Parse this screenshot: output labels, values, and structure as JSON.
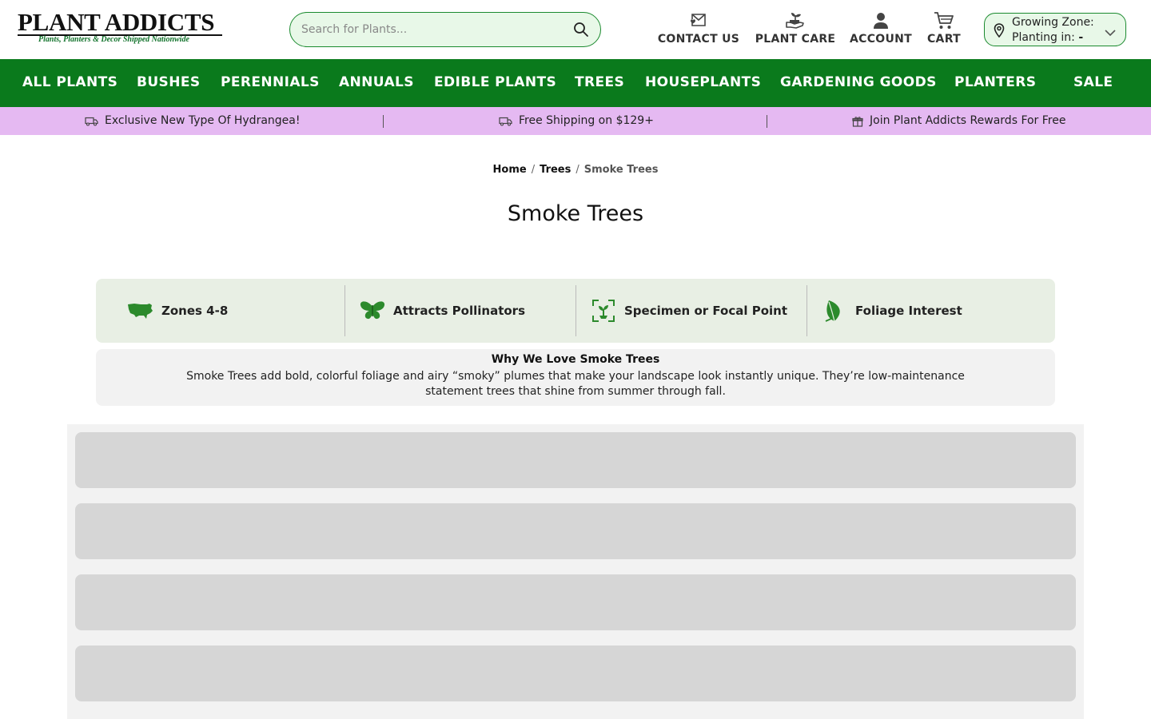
{
  "header": {
    "logo_title": "PLANT ADDICTS",
    "logo_tagline": "Plants, Planters & Decor Shipped Nationwide",
    "search_placeholder": "Search for Plants...",
    "links": [
      {
        "label": "CONTACT US",
        "icon": "envelope-heart-icon"
      },
      {
        "label": "PLANT CARE",
        "icon": "hand-sprout-icon"
      },
      {
        "label": "ACCOUNT",
        "icon": "user-icon"
      },
      {
        "label": "CART",
        "icon": "cart-icon"
      }
    ],
    "zone": {
      "line1": "Growing Zone:",
      "line2_label": "Planting in:",
      "line2_value": "-"
    }
  },
  "nav": [
    "ALL PLANTS",
    "BUSHES",
    "PERENNIALS",
    "ANNUALS",
    "EDIBLE PLANTS",
    "TREES",
    "HOUSEPLANTS",
    "GARDENING GOODS",
    "PLANTERS",
    "SALE"
  ],
  "promo": [
    {
      "text": "Exclusive New Type Of Hydrangea!",
      "icon": "truck-icon"
    },
    {
      "text": "Free Shipping on $129+",
      "icon": "truck-icon"
    },
    {
      "text": "Join Plant Addicts Rewards For Free",
      "icon": "gift-icon"
    }
  ],
  "breadcrumb": {
    "home": "Home",
    "trees": "Trees",
    "current": "Smoke Trees"
  },
  "page_title": "Smoke Trees",
  "features": [
    {
      "text": "Zones 4-8",
      "icon": "usa-map-icon"
    },
    {
      "text": "Attracts Pollinators",
      "icon": "butterfly-icon"
    },
    {
      "text": "Specimen or Focal Point",
      "icon": "focal-plant-icon"
    },
    {
      "text": "Foliage Interest",
      "icon": "leaf-icon"
    }
  ],
  "why": {
    "title": "Why We Love Smoke Trees",
    "body": "Smoke Trees add bold, colorful foliage and airy “smoky” plumes that make your landscape look instantly unique. They’re low-maintenance statement trees that shine from summer through fall."
  },
  "colors": {
    "brand_green": "#0a7a1c",
    "promo_purple": "#e5b9f2",
    "feature_bg": "#e8efe4",
    "skeleton": "#d6d6d6"
  }
}
